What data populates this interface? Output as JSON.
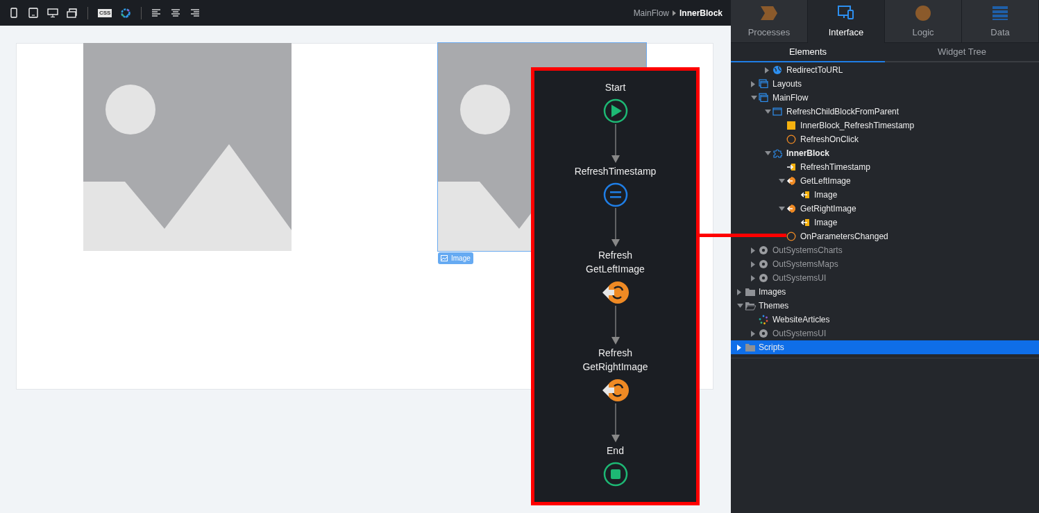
{
  "toolbar": {
    "tools": [
      {
        "kind": "phone"
      },
      {
        "kind": "tablet"
      },
      {
        "kind": "desktop"
      },
      {
        "kind": "rotate"
      },
      {
        "kind": "divider"
      },
      {
        "kind": "css",
        "text": "CSS"
      },
      {
        "kind": "theme"
      },
      {
        "kind": "divider"
      },
      {
        "kind": "align-left"
      },
      {
        "kind": "align-center"
      },
      {
        "kind": "align-right"
      }
    ],
    "breadcrumb": [
      "MainFlow",
      "InnerBlock"
    ]
  },
  "canvas": {
    "images": [
      {
        "selected": false
      },
      {
        "selected": true,
        "badge": "Image"
      }
    ]
  },
  "flow": {
    "nodes": [
      {
        "kind": "start",
        "label": "Start"
      },
      {
        "kind": "assign",
        "label": "RefreshTimestamp"
      },
      {
        "kind": "refresh",
        "label": "Refresh\nGetLeftImage"
      },
      {
        "kind": "refresh",
        "label": "Refresh\nGetRightImage"
      },
      {
        "kind": "end",
        "label": "End"
      }
    ]
  },
  "tabs": [
    {
      "label": "Processes",
      "kind": "processes",
      "selected": false
    },
    {
      "label": "Interface",
      "kind": "interface",
      "selected": true
    },
    {
      "label": "Logic",
      "kind": "logic",
      "selected": false
    },
    {
      "label": "Data",
      "kind": "data",
      "selected": false
    }
  ],
  "subtabs": [
    {
      "label": "Elements",
      "selected": true
    },
    {
      "label": "Widget Tree",
      "selected": false
    }
  ],
  "tree": [
    {
      "children": [
        {
          "children": [
            {
              "label": "RedirectToURL",
              "kind": "globe",
              "expanded": false,
              "selected": false
            }
          ]
        },
        {
          "label": "Layouts",
          "kind": "flow",
          "expanded": false,
          "selected": false
        },
        {
          "label": "MainFlow",
          "kind": "flow",
          "expanded": true,
          "selected": false,
          "children": [
            {
              "label": "RefreshChildBlockFromParent",
              "kind": "screen",
              "expanded": true,
              "selected": false,
              "children": [
                {
                  "label": "InnerBlock_RefreshTimestamp",
                  "kind": "action",
                  "selected": false
                },
                {
                  "label": "RefreshOnClick",
                  "kind": "event",
                  "selected": false
                }
              ]
            },
            {
              "label": "InnerBlock",
              "kind": "block",
              "expanded": true,
              "selected": false,
              "bold": true,
              "children": [
                {
                  "label": "RefreshTimestamp",
                  "kind": "input",
                  "selected": false
                },
                {
                  "label": "GetLeftImage",
                  "kind": "aggregate",
                  "expanded": true,
                  "selected": false,
                  "children": [
                    {
                      "label": "Image",
                      "kind": "output",
                      "selected": false
                    }
                  ]
                },
                {
                  "label": "GetRightImage",
                  "kind": "aggregate",
                  "expanded": true,
                  "selected": false,
                  "children": [
                    {
                      "label": "Image",
                      "kind": "output",
                      "selected": false
                    }
                  ]
                },
                {
                  "label": "OnParametersChanged",
                  "kind": "event",
                  "selected": false
                }
              ]
            }
          ]
        },
        {
          "label": "OutSystemsCharts",
          "kind": "module",
          "expanded": false,
          "selected": false
        },
        {
          "label": "OutSystemsMaps",
          "kind": "module",
          "expanded": false,
          "selected": false
        },
        {
          "label": "OutSystemsUI",
          "kind": "module",
          "expanded": false,
          "selected": false
        }
      ]
    },
    {
      "label": "Images",
      "kind": "folder",
      "expanded": false,
      "selected": false
    },
    {
      "label": "Themes",
      "kind": "folder",
      "expanded": true,
      "selected": false,
      "children": [
        {
          "label": "WebsiteArticles",
          "kind": "theme",
          "selected": false
        },
        {
          "label": "OutSystemsUI",
          "kind": "module",
          "expanded": false,
          "selected": false
        }
      ]
    },
    {
      "label": "Scripts",
      "kind": "folder",
      "expanded": false,
      "selected": true
    }
  ]
}
